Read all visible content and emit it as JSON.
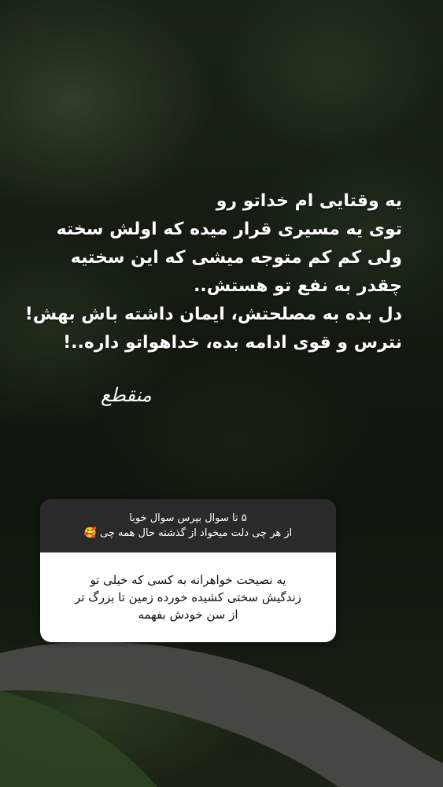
{
  "story": {
    "lines": [
      "یه وقتایی ام خداتو رو",
      "توی یه مسیری قرار میده که اولش سخته",
      "ولی کم کم متوجه میشی که این سختیه",
      "چقدر به نفع تو هستش..",
      "دل بده به مصلحتش، ایمان داشته باش بهش!",
      "نترس و قوی ادامه بده، خداهواتو داره..!"
    ],
    "signature": "منقطع"
  },
  "question_sticker": {
    "title": "۵ تا سوال بپرس سوال خوبا",
    "subtitle": "از هر چی دلت میخواد از گذشته حال همه چی 🥰",
    "answer_lines": [
      "یه نصیحت خواهرانه به کسی که خیلی تو",
      "زندگیش سختی کشیده خورده زمین تا بزرگ تر",
      "از سن خودش بفهمه"
    ]
  },
  "colors": {
    "text": "#ffffff",
    "question_bg": "#2a2a2a",
    "answer_bg": "#ffffff",
    "answer_text": "#111111"
  }
}
